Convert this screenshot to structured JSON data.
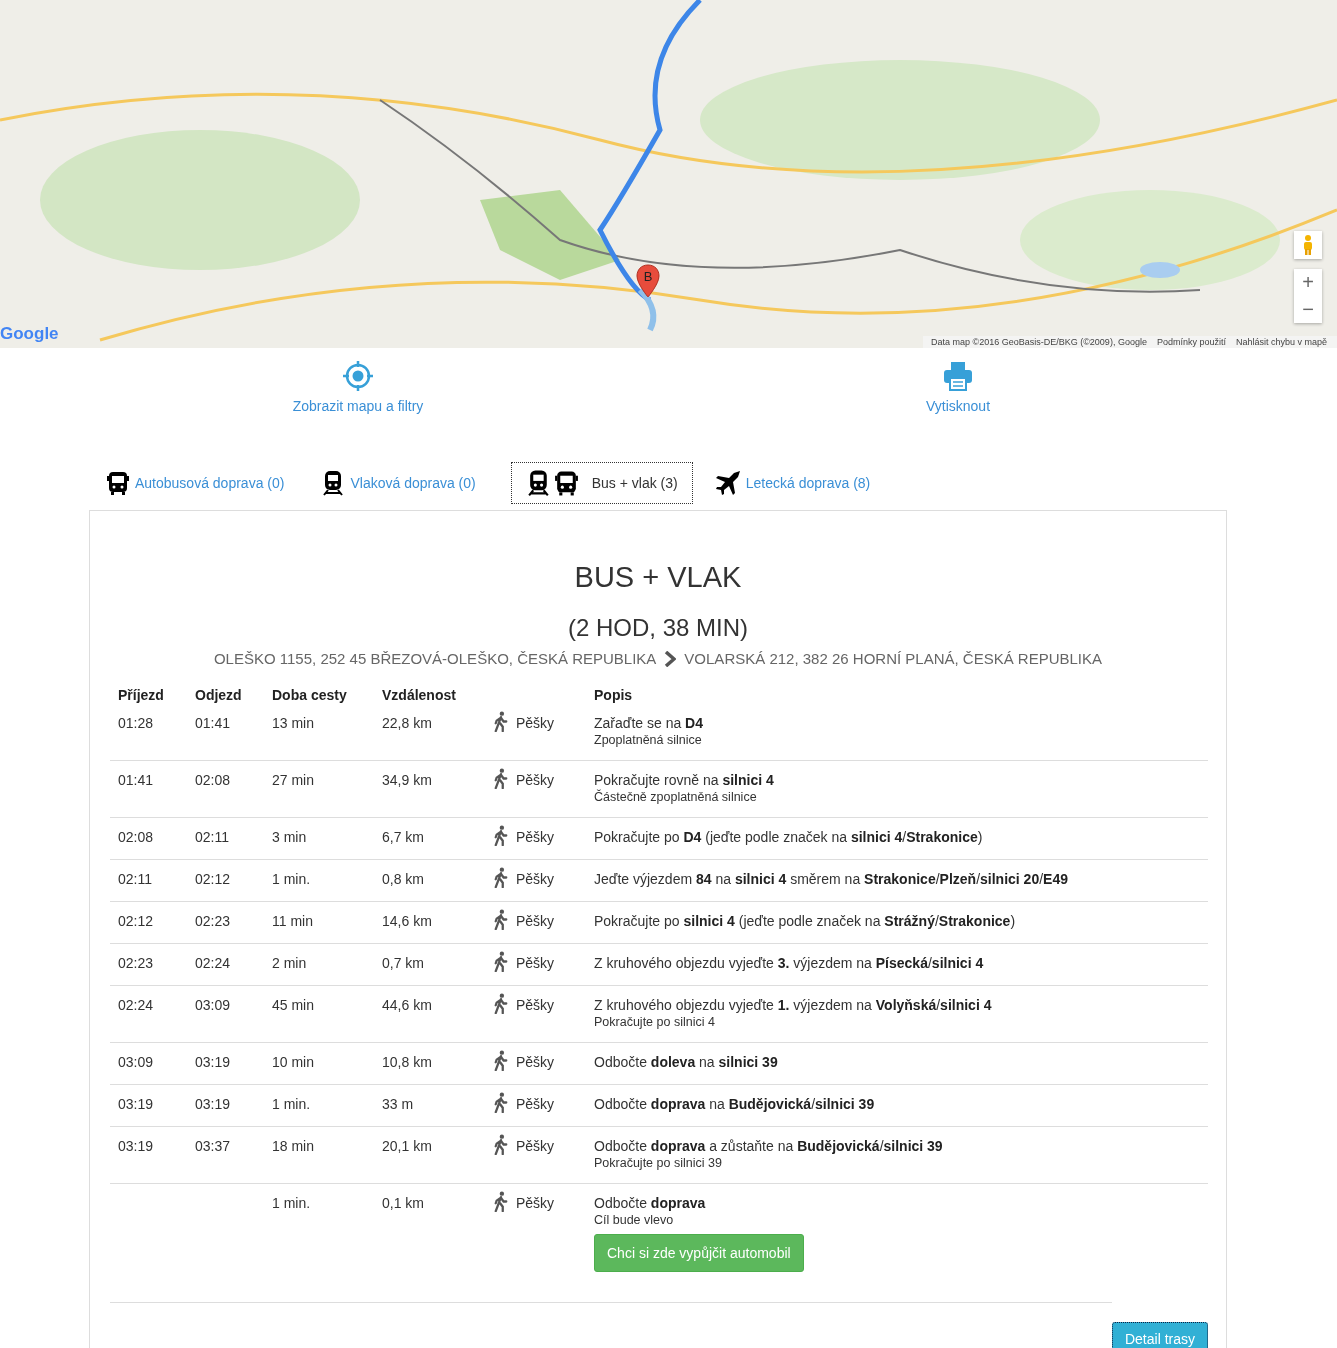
{
  "map": {
    "marker": "B",
    "logo": "Google",
    "attribution": [
      "Data map ©2016 GeoBasis-DE/BKG (©2009), Google",
      "Podmínky použití",
      "Nahlásit chybu v mapě"
    ],
    "zoom_in": "+",
    "zoom_out": "−"
  },
  "actions": [
    {
      "kind": "locate",
      "label": "Zobrazit mapu a filtry"
    },
    {
      "kind": "print",
      "label": "Vytisknout"
    }
  ],
  "tabs": [
    {
      "kind": "bus",
      "label": "Autobusová doprava (0)",
      "selected": false
    },
    {
      "kind": "train",
      "label": "Vlaková doprava (0)",
      "selected": false
    },
    {
      "kind": "bus-train",
      "label": "Bus + vlak (3)",
      "selected": true
    },
    {
      "kind": "plane",
      "label": "Letecká doprava (8)",
      "selected": false
    }
  ],
  "heading": "BUS + VLAK",
  "duration": "(2 HOD, 38 MIN)",
  "from": "OLEŠKO 1155, 252 45 BŘEZOVÁ-OLEŠKO, ČESKÁ REPUBLIKA",
  "to": "VOLARSKÁ 212, 382 26 HORNÍ PLANÁ, ČESKÁ REPUBLIKA",
  "table": {
    "columns": [
      "Příjezd",
      "Odjezd",
      "Doba cesty",
      "Vzdálenost",
      "Popis"
    ],
    "rows": [
      {
        "arrival": "01:28",
        "departure": "01:41",
        "duration": "13 min",
        "distance": "22,8 km",
        "mode": "Pěšky",
        "description": "Zařaďte se na **D4**",
        "note": "Zpoplatněná silnice"
      },
      {
        "arrival": "01:41",
        "departure": "02:08",
        "duration": "27 min",
        "distance": "34,9 km",
        "mode": "Pěšky",
        "description": "Pokračujte rovně na **silnici 4**",
        "note": "Částečně zpoplatněná silnice"
      },
      {
        "arrival": "02:08",
        "departure": "02:11",
        "duration": "3 min",
        "distance": "6,7 km",
        "mode": "Pěšky",
        "description": "Pokračujte po **D4** (jeďte podle značek na **silnici 4**/**Strakonice**)"
      },
      {
        "arrival": "02:11",
        "departure": "02:12",
        "duration": "1 min.",
        "distance": "0,8 km",
        "mode": "Pěšky",
        "description": "Jeďte výjezdem **84** na **silnici 4** směrem na **Strakonice**/**Plzeň**/**silnici 20**/**E49**"
      },
      {
        "arrival": "02:12",
        "departure": "02:23",
        "duration": "11 min",
        "distance": "14,6 km",
        "mode": "Pěšky",
        "description": "Pokračujte po **silnici 4** (jeďte podle značek na **Strážný**/**Strakonice**)"
      },
      {
        "arrival": "02:23",
        "departure": "02:24",
        "duration": "2 min",
        "distance": "0,7 km",
        "mode": "Pěšky",
        "description": "Z kruhového objezdu vyjeďte **3.** výjezdem na **Písecká**/**silnici 4**"
      },
      {
        "arrival": "02:24",
        "departure": "03:09",
        "duration": "45 min",
        "distance": "44,6 km",
        "mode": "Pěšky",
        "description": "Z kruhového objezdu vyjeďte **1.** výjezdem na **Volyňská**/**silnici 4**",
        "note": "Pokračujte po silnici 4"
      },
      {
        "arrival": "03:09",
        "departure": "03:19",
        "duration": "10 min",
        "distance": "10,8 km",
        "mode": "Pěšky",
        "description": "Odbočte **doleva** na **silnici 39**"
      },
      {
        "arrival": "03:19",
        "departure": "03:19",
        "duration": "1 min.",
        "distance": "33 m",
        "mode": "Pěšky",
        "description": "Odbočte **doprava** na **Budějovická**/**silnici 39**"
      },
      {
        "arrival": "03:19",
        "departure": "03:37",
        "duration": "18 min",
        "distance": "20,1 km",
        "mode": "Pěšky",
        "description": "Odbočte **doprava** a zůstaňte na **Budějovická**/**silnici 39**",
        "note": "Pokračujte po silnici 39"
      },
      {
        "duration": "1 min.",
        "distance": "0,1 km",
        "mode": "Pěšky",
        "description": "Odbočte **doprava**",
        "note": "Cíl bude vlevo",
        "button": "Chci si zde vypůjčit automobil"
      }
    ]
  },
  "detail_button": "Detail trasy"
}
